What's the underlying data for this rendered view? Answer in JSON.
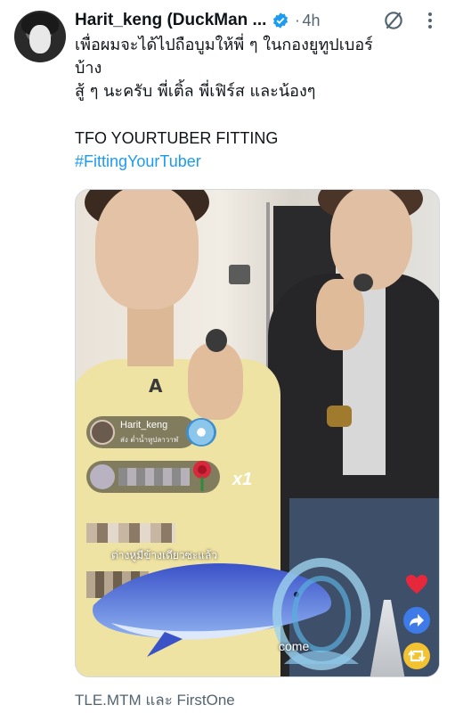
{
  "author": {
    "display_name": "Harit_keng (DuckMan ...",
    "verified": true,
    "timestamp": "4h"
  },
  "tweet": {
    "lines": [
      "เพื่อผมจะได้ไปถือบูมให้พี่ ๆ ในกองยูทูปเบอร์",
      "บ้าง",
      "สู้ ๆ นะครับ พี่เติ้ล พี่เฟิร์ส และน้องๆ"
    ],
    "title_line": "TFO YOURTUBER FITTING",
    "hashtag": "#FittingYourTuber"
  },
  "media": {
    "live_user": "Harit_keng",
    "live_user_sub": "ส่ง ต่ำน้ำหูปลาวาฬ",
    "gift_multiplier": "x1",
    "comment_2": "ต่างหูมีข้างเดียวซะแล้ว",
    "comment_3": "come",
    "print_text": "A"
  },
  "footer": {
    "mentions": "TLE.MTM และ FirstOne"
  },
  "colors": {
    "link": "#1d9bf0",
    "secondary_text": "#536471",
    "verified": "#1d9bf0"
  },
  "icons": [
    "verified-badge-icon",
    "grok-icon",
    "more-icon",
    "heart-icon",
    "share-icon",
    "retweet-icon"
  ]
}
